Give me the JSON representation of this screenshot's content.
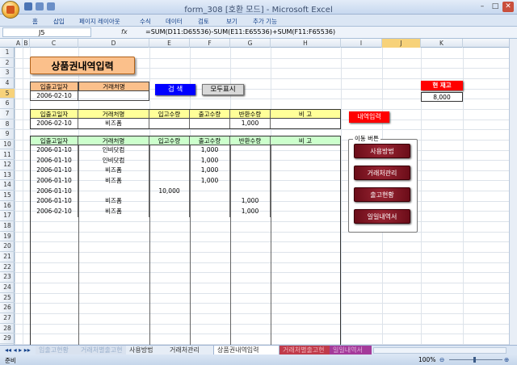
{
  "window": {
    "title": "form_308  [호환 모드] - Microsoft Excel",
    "min": "–",
    "max": "□",
    "close": "✕"
  },
  "ribbon": {
    "tabs": [
      "홈",
      "삽입",
      "페이지 레이아웃",
      "수식",
      "데이터",
      "검토",
      "보기",
      "추가 기능"
    ]
  },
  "formula_bar": {
    "cell_ref": "J5",
    "fx": "fx",
    "formula": "=SUM(D11:D65536)-SUM(E11:E65536)+SUM(F11:F65536)"
  },
  "columns": [
    "A",
    "B",
    "C",
    "D",
    "E",
    "F",
    "G",
    "H",
    "I",
    "J",
    "K"
  ],
  "rows": [
    "1",
    "2",
    "3",
    "4",
    "5",
    "6",
    "7",
    "8",
    "9",
    "10",
    "11",
    "12",
    "13",
    "14",
    "15",
    "16",
    "17",
    "18",
    "19",
    "20",
    "21",
    "22",
    "23",
    "24",
    "25",
    "26",
    "27",
    "28",
    "29"
  ],
  "sheet": {
    "title": "상품권내역입력",
    "search_header": {
      "date": "입출고일자",
      "vendor": "거래처명"
    },
    "search_values": {
      "date": "2006-02-10",
      "vendor": ""
    },
    "search_button": "검  색",
    "show_all_button": "모두표시",
    "stock_label": "현 재고",
    "stock_value": "8,000",
    "entry_headers": [
      "입출고일자",
      "거래처명",
      "입고수량",
      "출고수량",
      "반환수량",
      "비  고"
    ],
    "entry_row": [
      "2006-02-10",
      "비즈폼",
      "",
      "",
      "1,000",
      ""
    ],
    "entry_button": "내역입력",
    "list_headers": [
      "입출고일자",
      "거래처명",
      "입고수량",
      "출고수량",
      "반환수량",
      "비  고"
    ],
    "list_rows": [
      [
        "2006-01-10",
        "인비닷컴",
        "",
        "1,000",
        "",
        ""
      ],
      [
        "2006-01-10",
        "인비닷컴",
        "",
        "1,000",
        "",
        ""
      ],
      [
        "2006-01-10",
        "비즈폼",
        "",
        "1,000",
        "",
        ""
      ],
      [
        "2006-01-10",
        "비즈폼",
        "",
        "1,000",
        "",
        ""
      ],
      [
        "2006-01-10",
        "",
        "10,000",
        "",
        "",
        ""
      ],
      [
        "2006-01-10",
        "비즈폼",
        "",
        "",
        "1,000",
        ""
      ],
      [
        "2006-02-10",
        "비즈폼",
        "",
        "",
        "1,000",
        ""
      ]
    ],
    "nav_group_label": "이동 버튼",
    "nav_buttons": [
      "사용방법",
      "거래처관리",
      "출고현황",
      "일일내역서"
    ]
  },
  "sheet_tabs": [
    "입출고현황",
    "거래처별출고현황",
    "사용방법",
    "거래처관리",
    "상품권내역입력",
    "거래처별출고현황",
    "일일내역서"
  ],
  "status": {
    "ready": "준비",
    "zoom": "100%"
  },
  "colors": {
    "accent_yellow": "#ffff99",
    "title_orange": "#fbc08b",
    "list_green": "#ccffcc",
    "search_blue": "#0000ff",
    "stock_red": "#ff0000",
    "nav_dark_red": "#7a1220"
  }
}
